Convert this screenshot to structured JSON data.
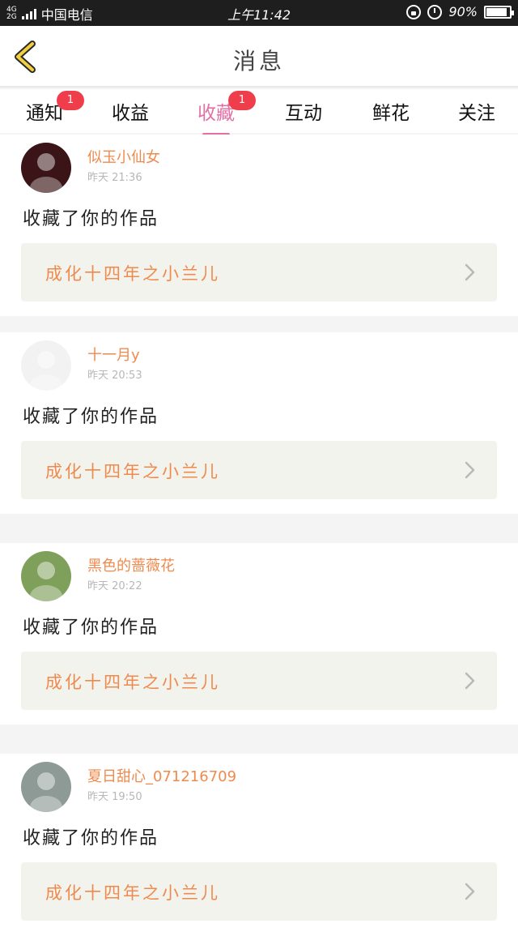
{
  "status_bar": {
    "network": "4G\n2G",
    "carrier": "中国电信",
    "time": "上午11:42",
    "battery_text": "90%",
    "battery_level": 0.9,
    "icons": [
      "signal-icon",
      "lock-rotation-icon",
      "alarm-icon",
      "battery-icon"
    ]
  },
  "header": {
    "title": "消息",
    "back_icon": "chevron-left-icon",
    "accent": "#f2cf3c"
  },
  "tabs": [
    {
      "label": "通知",
      "badge": "1",
      "active": false
    },
    {
      "label": "收益",
      "badge": "",
      "active": false
    },
    {
      "label": "收藏",
      "badge": "1",
      "active": true
    },
    {
      "label": "互动",
      "badge": "",
      "active": false
    },
    {
      "label": "鲜花",
      "badge": "",
      "active": false
    },
    {
      "label": "关注",
      "badge": "",
      "active": false
    }
  ],
  "feed": [
    {
      "user": "似玉小仙女",
      "time": "昨天 21:36",
      "action": "收藏了你的作品",
      "work": "成化十四年之小兰儿",
      "avatar_color": "#3a1416"
    },
    {
      "user": "十一月y",
      "time": "昨天 20:53",
      "action": "收藏了你的作品",
      "work": "成化十四年之小兰儿",
      "avatar_color": "#f2f2f2"
    },
    {
      "user": "黑色的蔷薇花",
      "time": "昨天 20:22",
      "action": "收藏了你的作品",
      "work": "成化十四年之小兰儿",
      "avatar_color": "#7fa05a"
    },
    {
      "user": "夏日甜心_071216709",
      "time": "昨天 19:50",
      "action": "收藏了你的作品",
      "work": "成化十四年之小兰儿",
      "avatar_color": "#8e9a96"
    }
  ],
  "colors": {
    "active_tab": "#e46fa4",
    "badge": "#f03d4b",
    "username": "#ef8a4e",
    "work_bg": "#f3f3ed"
  }
}
